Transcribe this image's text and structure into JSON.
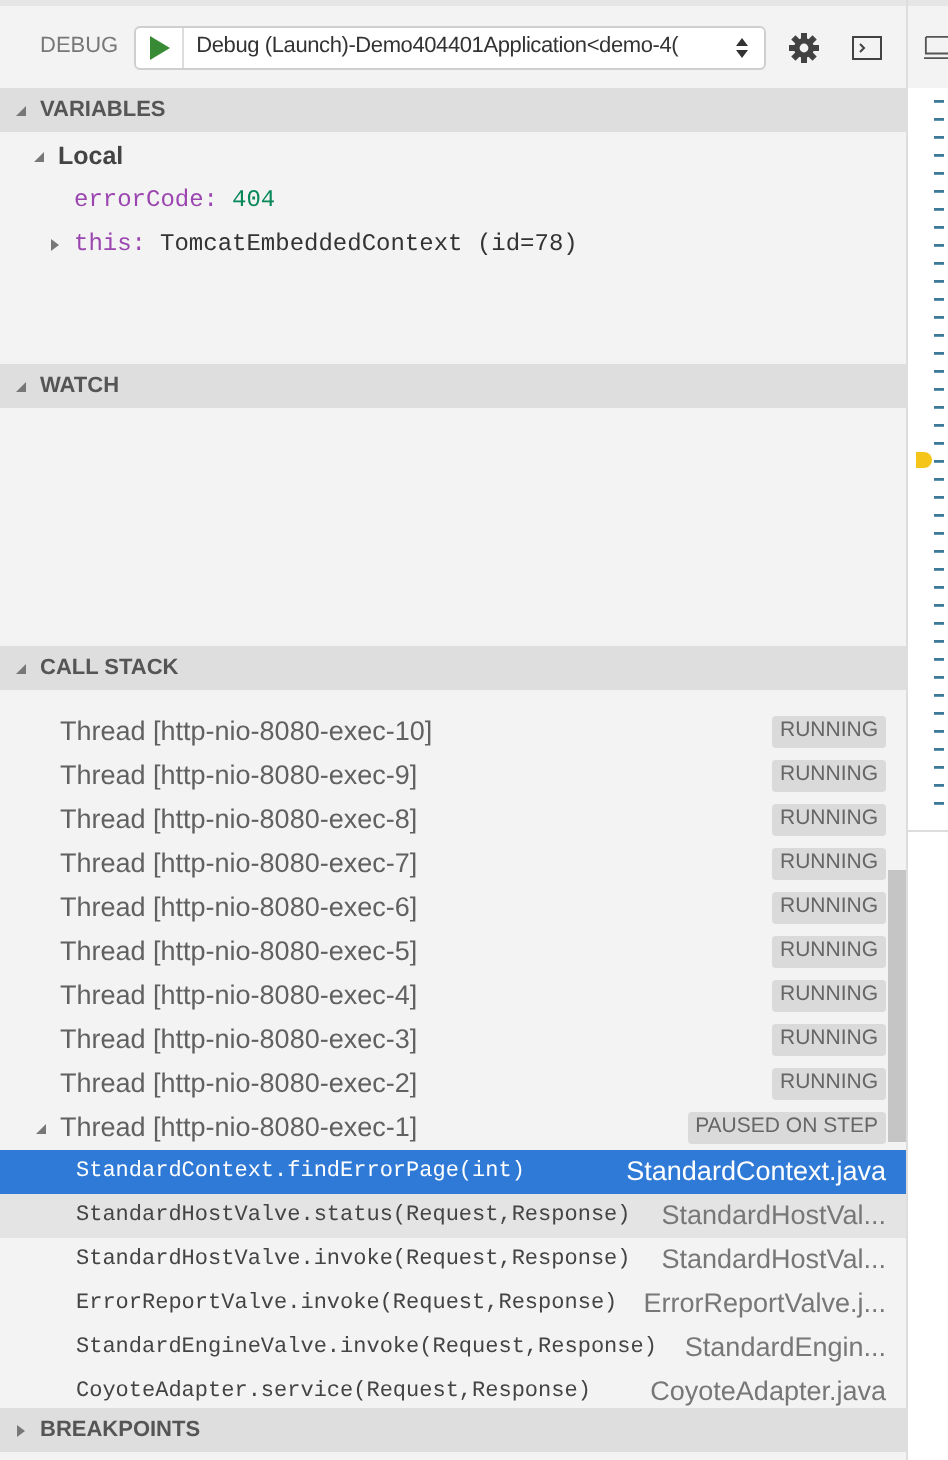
{
  "toolbar": {
    "label": "DEBUG",
    "configuration": "Debug (Launch)-Demo404401Application<demo-4("
  },
  "variables": {
    "title": "VARIABLES",
    "expanded": true,
    "scopes": [
      {
        "name": "Local",
        "expanded": true,
        "children": [
          {
            "name": "errorCode:",
            "value": "404",
            "kind": "number",
            "expandable": false
          },
          {
            "name": "this:",
            "value": "TomcatEmbeddedContext (id=78)",
            "kind": "object",
            "expandable": true
          }
        ]
      }
    ]
  },
  "watch": {
    "title": "WATCH"
  },
  "call_stack": {
    "title": "CALL STACK",
    "expanded": true,
    "rows": [
      {
        "kind": "thread",
        "label": "Thread [http-nio-8080-exec-10]",
        "status": "RUNNING",
        "expanded": false
      },
      {
        "kind": "thread",
        "label": "Thread [http-nio-8080-exec-9]",
        "status": "RUNNING",
        "expanded": false
      },
      {
        "kind": "thread",
        "label": "Thread [http-nio-8080-exec-8]",
        "status": "RUNNING",
        "expanded": false
      },
      {
        "kind": "thread",
        "label": "Thread [http-nio-8080-exec-7]",
        "status": "RUNNING",
        "expanded": false
      },
      {
        "kind": "thread",
        "label": "Thread [http-nio-8080-exec-6]",
        "status": "RUNNING",
        "expanded": false
      },
      {
        "kind": "thread",
        "label": "Thread [http-nio-8080-exec-5]",
        "status": "RUNNING",
        "expanded": false
      },
      {
        "kind": "thread",
        "label": "Thread [http-nio-8080-exec-4]",
        "status": "RUNNING",
        "expanded": false
      },
      {
        "kind": "thread",
        "label": "Thread [http-nio-8080-exec-3]",
        "status": "RUNNING",
        "expanded": false
      },
      {
        "kind": "thread",
        "label": "Thread [http-nio-8080-exec-2]",
        "status": "RUNNING",
        "expanded": false
      },
      {
        "kind": "thread",
        "label": "Thread [http-nio-8080-exec-1]",
        "status": "PAUSED ON STEP",
        "expanded": true
      },
      {
        "kind": "frame",
        "label": "StandardContext.findErrorPage(int)",
        "file": "StandardContext.java",
        "selected": true,
        "hovered": false
      },
      {
        "kind": "frame",
        "label": "StandardHostValve.status(Request,Response)",
        "file": "StandardHostVal...",
        "selected": false,
        "hovered": true
      },
      {
        "kind": "frame",
        "label": "StandardHostValve.invoke(Request,Response)",
        "file": "StandardHostVal...",
        "selected": false,
        "hovered": false
      },
      {
        "kind": "frame",
        "label": "ErrorReportValve.invoke(Request,Response)",
        "file": "ErrorReportValve.j...",
        "selected": false,
        "hovered": false
      },
      {
        "kind": "frame",
        "label": "StandardEngineValve.invoke(Request,Response)",
        "file": "StandardEngin...",
        "selected": false,
        "hovered": false
      },
      {
        "kind": "frame",
        "label": "CoyoteAdapter.service(Request,Response)",
        "file": "CoyoteAdapter.java",
        "selected": false,
        "hovered": false
      }
    ]
  },
  "breakpoints": {
    "title": "BREAKPOINTS",
    "expanded": false
  }
}
